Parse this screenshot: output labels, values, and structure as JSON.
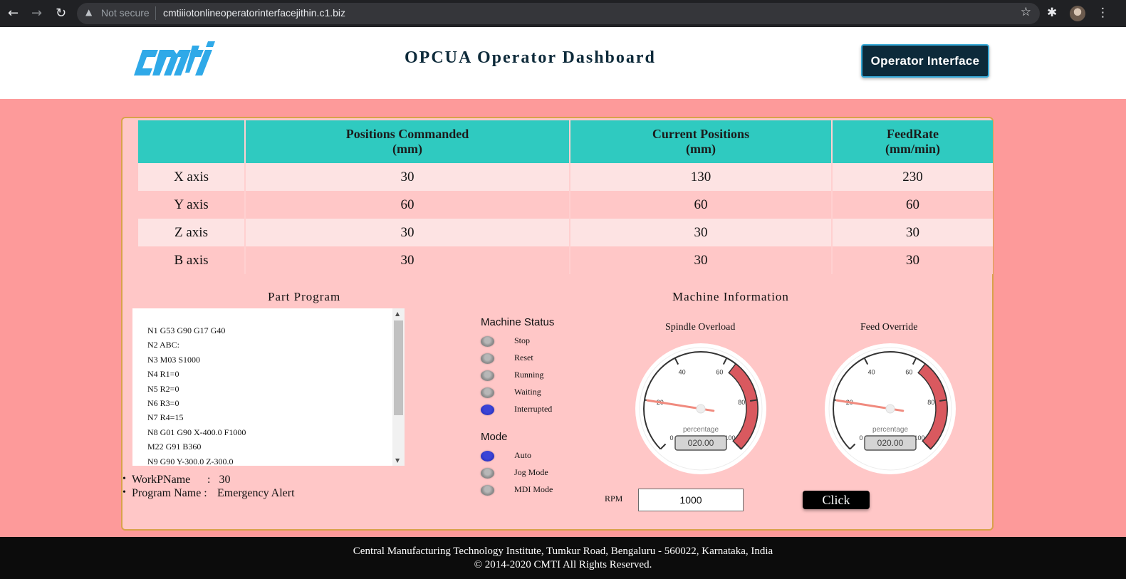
{
  "browser": {
    "back_icon": "arrow-left-icon",
    "forward_icon": "arrow-right-icon",
    "reload_icon": "reload-icon",
    "security_text": "Not secure",
    "url": "cmtiiiotonlineoperatorinterfacejithin.c1.biz"
  },
  "header": {
    "logo_text": "cmti",
    "title": "OPCUA Operator Dashboard",
    "operator_button": "Operator Interface"
  },
  "axes_table": {
    "headers": [
      {
        "line1": "",
        "line2": ""
      },
      {
        "line1": "Positions Commanded",
        "line2": "(mm)"
      },
      {
        "line1": "Current Positions",
        "line2": "(mm)"
      },
      {
        "line1": "FeedRate",
        "line2": "(mm/min)"
      }
    ],
    "rows": [
      {
        "axis": "X axis",
        "commanded": "30",
        "current": "130",
        "feedrate": "230"
      },
      {
        "axis": "Y axis",
        "commanded": "60",
        "current": "60",
        "feedrate": "60"
      },
      {
        "axis": "Z axis",
        "commanded": "30",
        "current": "30",
        "feedrate": "30"
      },
      {
        "axis": "B axis",
        "commanded": "30",
        "current": "30",
        "feedrate": "30"
      }
    ]
  },
  "part_program": {
    "title": "Part Program",
    "lines": [
      "N1 G53 G90 G17 G40",
      "N2 ABC:",
      "N3 M03 S1000",
      "N4 R1=0",
      "N5 R2=0",
      "N6 R3=0",
      "N7 R4=15",
      "N8 G01 G90 X-400.0 F1000",
      "M22 G91 B360",
      "N9 G90 Y-300.0 Z-300.0"
    ],
    "work_pname_label": "WorkPName",
    "work_pname_sep": ":",
    "work_pname_value": "30",
    "program_name_label": "Program Name :",
    "program_name_value": "Emergency Alert"
  },
  "machine_status": {
    "title": "Machine Status",
    "items": [
      {
        "label": "Stop",
        "active": false
      },
      {
        "label": "Reset",
        "active": false
      },
      {
        "label": "Running",
        "active": false
      },
      {
        "label": "Waiting",
        "active": false
      },
      {
        "label": "Interrupted",
        "active": true
      }
    ]
  },
  "mode": {
    "title": "Mode",
    "items": [
      {
        "label": "Auto",
        "active": true
      },
      {
        "label": "Jog Mode",
        "active": false
      },
      {
        "label": "MDI Mode",
        "active": false
      }
    ]
  },
  "machine_info": {
    "title": "Machine Information",
    "gauges": [
      {
        "title": "Spindle Overload",
        "value": 20,
        "display": "020.00",
        "unit": "percentage",
        "min": 0,
        "max": 100,
        "ticks": [
          "0",
          "20",
          "40",
          "60",
          "80",
          "100"
        ],
        "red_from": 64
      },
      {
        "title": "Feed Override",
        "value": 20,
        "display": "020.00",
        "unit": "percentage",
        "min": 0,
        "max": 100,
        "ticks": [
          "0",
          "20",
          "40",
          "60",
          "80",
          "100"
        ],
        "red_from": 64
      }
    ],
    "rpm_label": "RPM",
    "rpm_value": "1000",
    "click_button": "Click"
  },
  "colors": {
    "page_bg": "#fd9a9a",
    "panel_bg": "#ffc7c7",
    "table_header": "#2fcac0",
    "header_button": "#0d2a3a",
    "gauge_red": "#d9595f",
    "led_active": "#1e26b0",
    "logo_blue": "#2fa9e8"
  },
  "footer": {
    "line1": "Central Manufacturing Technology Institute, Tumkur Road, Bengaluru - 560022, Karnataka, India",
    "line2": "© 2014-2020 CMTI All Rights Reserved."
  }
}
